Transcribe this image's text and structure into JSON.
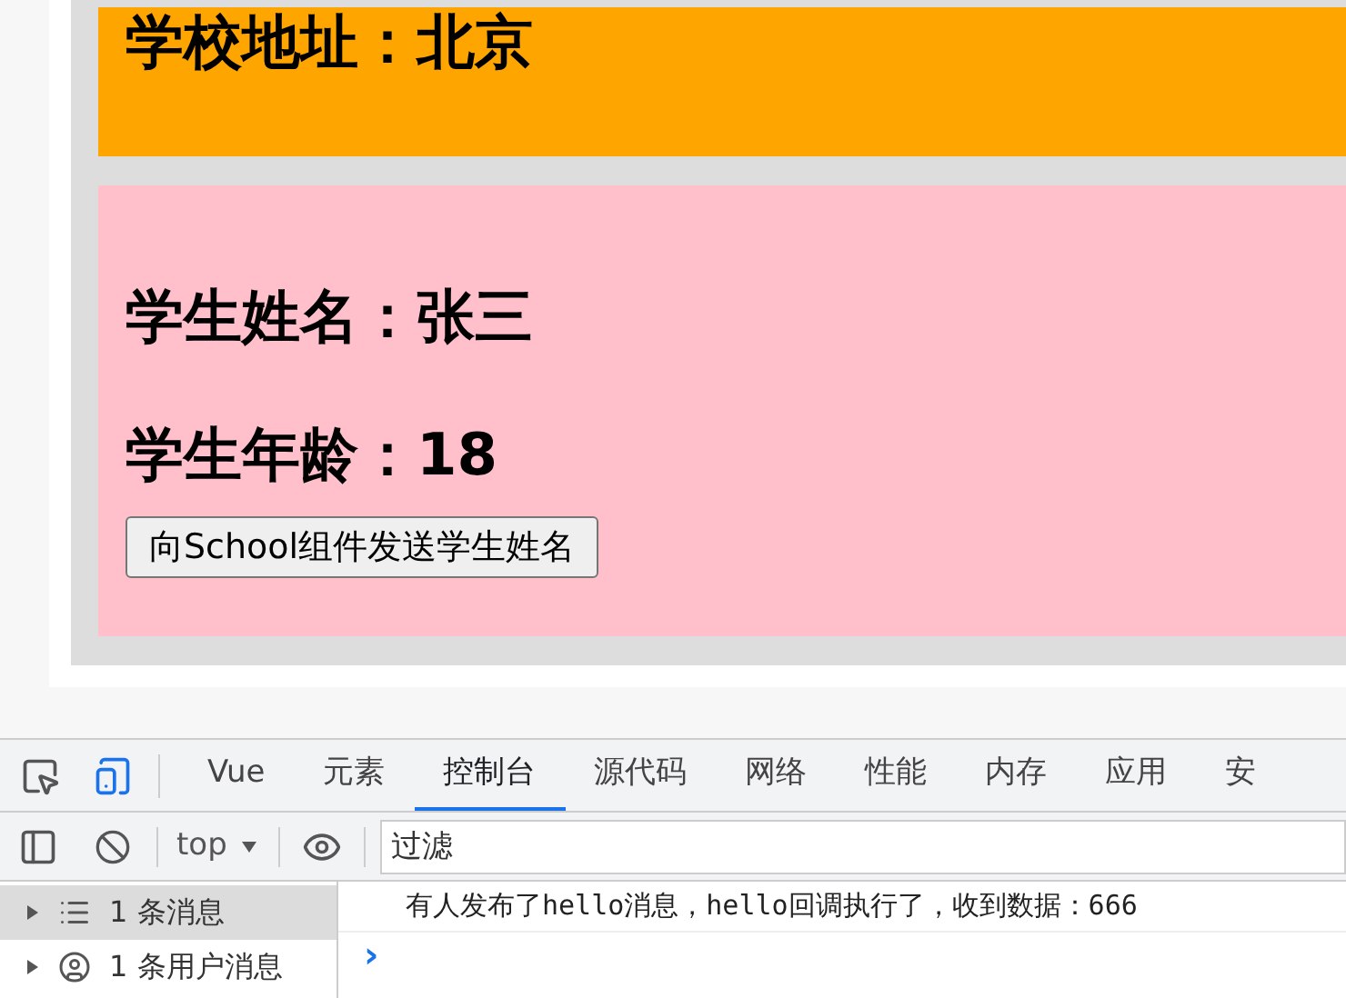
{
  "school": {
    "address": "学校地址：北京"
  },
  "student": {
    "name": "学生姓名：张三",
    "age": "学生年龄：18",
    "button": "向School组件发送学生姓名"
  },
  "devtools": {
    "tabs": [
      {
        "label": "Vue",
        "selected": false
      },
      {
        "label": "元素",
        "selected": false
      },
      {
        "label": "控制台",
        "selected": true
      },
      {
        "label": "源代码",
        "selected": false
      },
      {
        "label": "网络",
        "selected": false
      },
      {
        "label": "性能",
        "selected": false
      },
      {
        "label": "内存",
        "selected": false
      },
      {
        "label": "应用",
        "selected": false
      },
      {
        "label": "安",
        "selected": false
      }
    ],
    "context": "top",
    "filter": {
      "placeholder": "过滤"
    },
    "sidebar": [
      {
        "label": "1 条消息",
        "kind": "messages",
        "selected": true
      },
      {
        "label": "1 条用户消息",
        "kind": "user",
        "selected": false
      }
    ],
    "messages": [
      "有人发布了hello消息，hello回调执行了，收到数据：666"
    ],
    "prompt": "›"
  }
}
